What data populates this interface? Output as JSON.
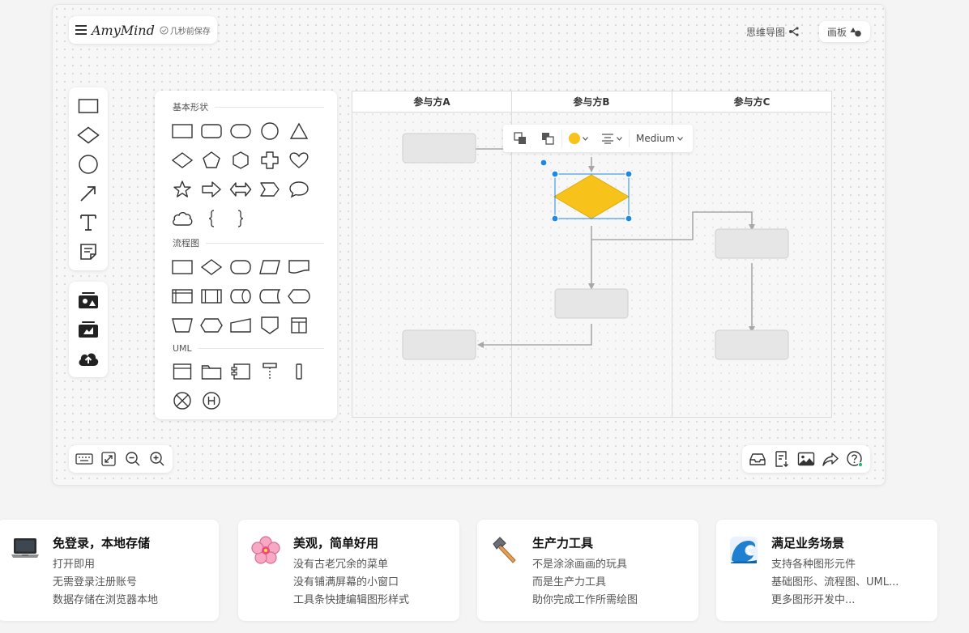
{
  "app": {
    "logo": "AmyMind",
    "save_status": "几秒前保存",
    "modes": [
      {
        "label": "思维导图"
      },
      {
        "label": "画板"
      }
    ]
  },
  "shape_panel": {
    "sections": [
      {
        "title": "基本形状"
      },
      {
        "title": "流程图"
      },
      {
        "title": "UML"
      }
    ]
  },
  "swimlanes": {
    "lanes": [
      "参与方A",
      "参与方B",
      "参与方C"
    ]
  },
  "float_toolbar": {
    "fill_color": "#f7c21a",
    "stroke_width": "Medium"
  },
  "colors": {
    "selection": "#1e88e5",
    "diamond_fill": "#f7c21a",
    "node_fill": "#e6e6e6",
    "connector": "#a8a8a8"
  },
  "features": [
    {
      "title": "免登录，本地存储",
      "lines": [
        "打开即用",
        "无需登录注册账号",
        "数据存储在浏览器本地"
      ],
      "icon": "laptop-icon"
    },
    {
      "title": "美观，简单好用",
      "lines": [
        "没有古老冗余的菜单",
        "没有铺满屏幕的小窗口",
        "工具条快捷编辑图形样式"
      ],
      "icon": "cherry-blossom-icon"
    },
    {
      "title": "生产力工具",
      "lines": [
        "不是涂涂画画的玩具",
        "而是生产力工具",
        "助你完成工作所需绘图"
      ],
      "icon": "hammer-icon"
    },
    {
      "title": "满足业务场景",
      "lines": [
        "支持各种图形元件",
        "基础图形、流程图、UML...",
        "更多图形开发中..."
      ],
      "icon": "wave-icon"
    }
  ]
}
